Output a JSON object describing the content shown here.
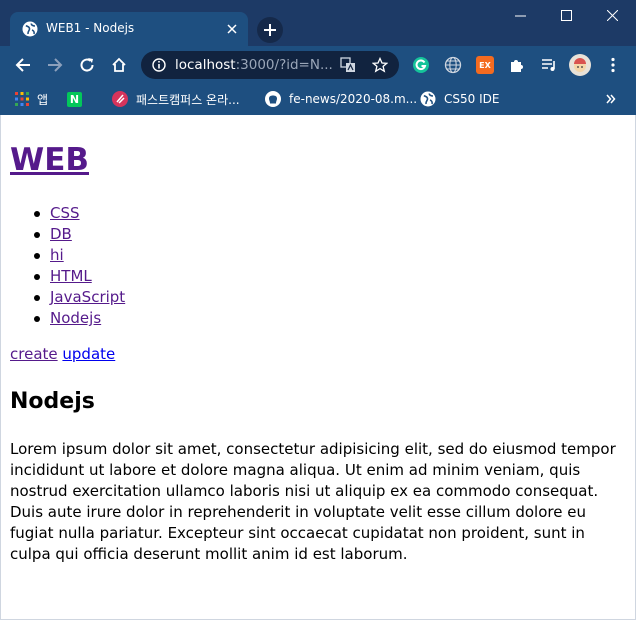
{
  "tab": {
    "title": "WEB1 - Nodejs"
  },
  "omnibox": {
    "host": "localhost",
    "rest": ":3000/?id=N..."
  },
  "bookmarks": [
    {
      "label": "앱"
    },
    {
      "label": "패스트캠퍼스 온라..."
    },
    {
      "label": "fe-news/2020-08.m..."
    },
    {
      "label": "CS50 IDE"
    }
  ],
  "extensions": {
    "ex_label": "EX"
  },
  "page": {
    "site_title": "WEB",
    "topics": [
      "CSS",
      "DB",
      "hi",
      "HTML",
      "JavaScript",
      "Nodejs"
    ],
    "create_label": "create",
    "update_label": "update",
    "heading": "Nodejs",
    "body": "Lorem ipsum dolor sit amet, consectetur adipisicing elit, sed do eiusmod tempor incididunt ut labore et dolore magna aliqua. Ut enim ad minim veniam, quis nostrud exercitation ullamco laboris nisi ut aliquip ex ea commodo consequat. Duis aute irure dolor in reprehenderit in voluptate velit esse cillum dolore eu fugiat nulla pariatur. Excepteur sint occaecat cupidatat non proident, sunt in culpa qui officia deserunt mollit anim id est laborum."
  },
  "colors": {
    "frame": "#1d3a66",
    "toolbar": "#1e4f80",
    "visited_link": "#551a8b",
    "link": "#0000ee"
  }
}
